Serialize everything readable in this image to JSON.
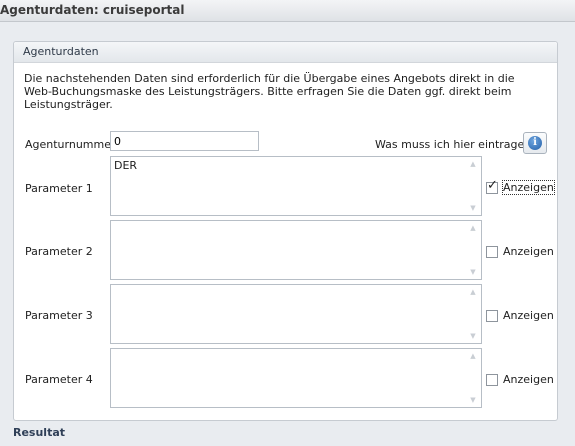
{
  "window": {
    "title": "Agenturdaten: cruiseportal"
  },
  "group": {
    "title": "Agenturdaten",
    "description_line1": "Die nachstehenden Daten sind erforderlich für die Übergabe eines Angebots direkt in die",
    "description_line2": "Web-Buchungsmaske des Leistungsträgers. Bitte erfragen Sie die Daten ggf. direkt beim Leistungsträger."
  },
  "agency_number": {
    "label": "Agenturnummer",
    "value": "0"
  },
  "help": {
    "question": "Was muss ich hier eintragen?",
    "icon": "info-icon"
  },
  "parameters": [
    {
      "label": "Parameter 1",
      "value": "DER",
      "show_label": "Anzeigen",
      "checked": true
    },
    {
      "label": "Parameter 2",
      "value": "",
      "show_label": "Anzeigen",
      "checked": false
    },
    {
      "label": "Parameter 3",
      "value": "",
      "show_label": "Anzeigen",
      "checked": false
    },
    {
      "label": "Parameter 4",
      "value": "",
      "show_label": "Anzeigen",
      "checked": false
    }
  ],
  "footer": {
    "label": "Resultat"
  }
}
